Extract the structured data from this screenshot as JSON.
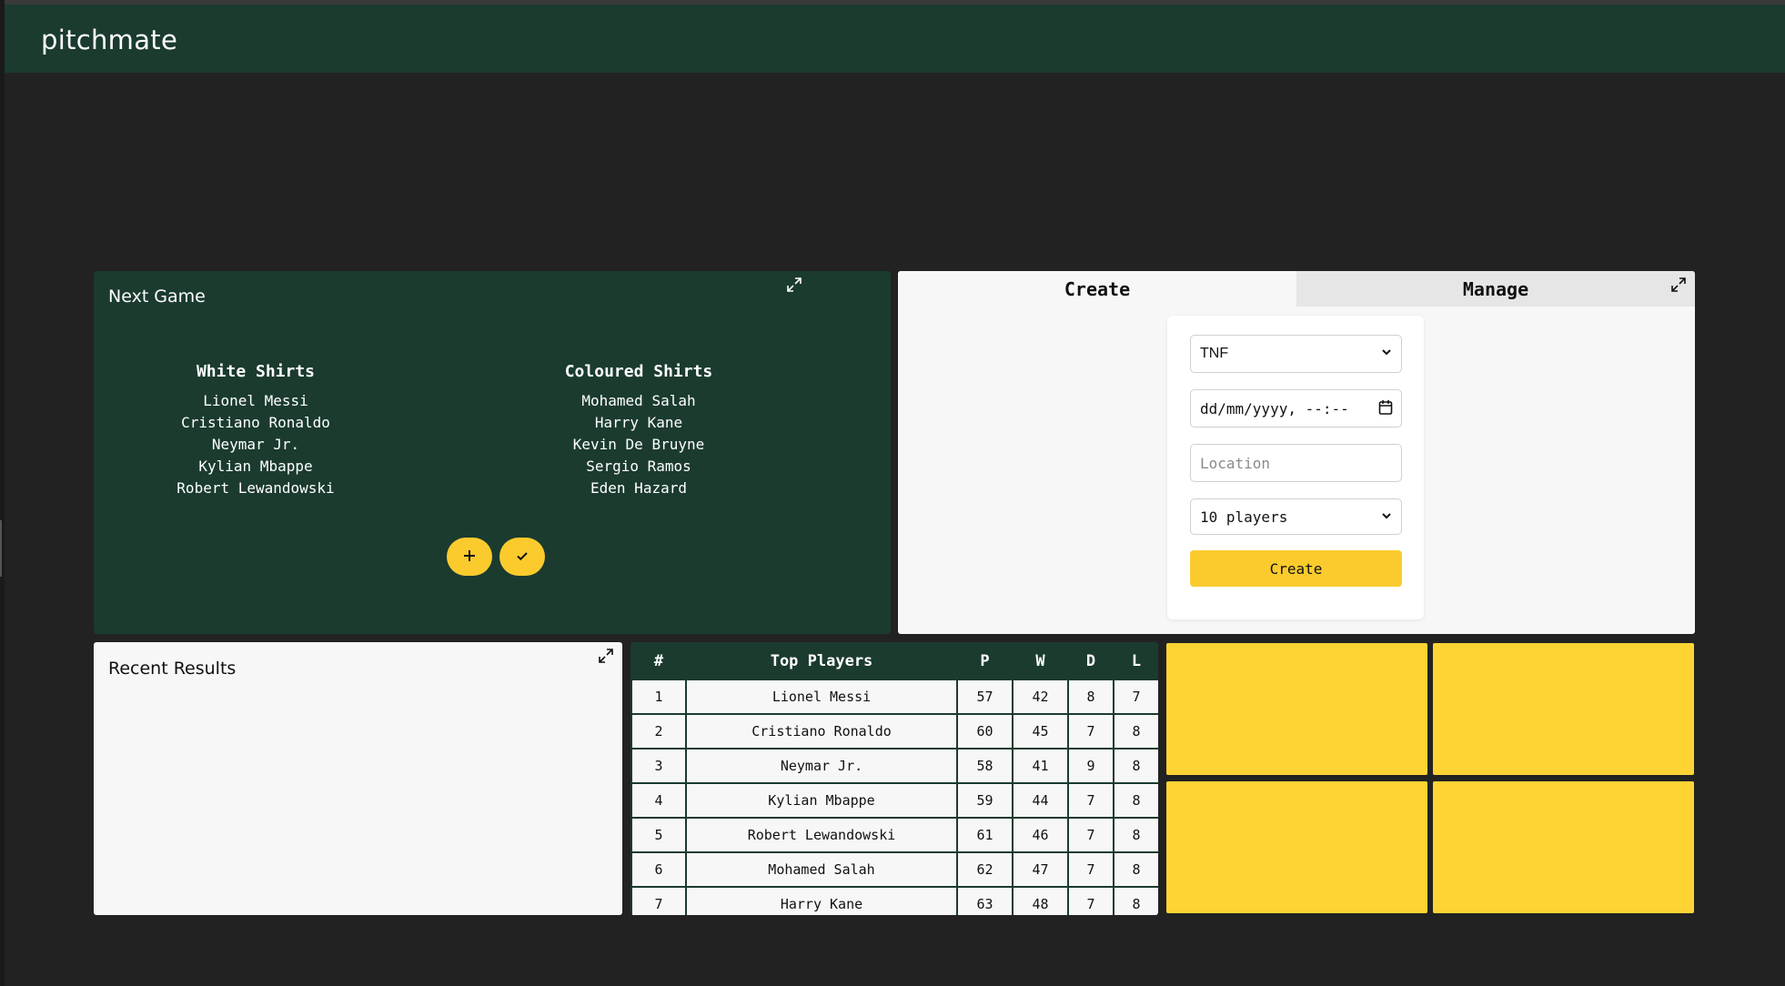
{
  "app": {
    "brand": "pitchmate"
  },
  "next_game": {
    "title": "Next Game",
    "teams": [
      {
        "name": "White Shirts",
        "players": [
          "Lionel Messi",
          "Cristiano Ronaldo",
          "Neymar Jr.",
          "Kylian Mbappe",
          "Robert Lewandowski"
        ]
      },
      {
        "name": "Coloured Shirts",
        "players": [
          "Mohamed Salah",
          "Harry Kane",
          "Kevin De Bruyne",
          "Sergio Ramos",
          "Eden Hazard"
        ]
      }
    ],
    "actions": {
      "add_icon": "plus-icon",
      "confirm_icon": "check-icon",
      "expand_icon": "expand-icon"
    }
  },
  "create_panel": {
    "tabs": [
      "Create",
      "Manage"
    ],
    "active_tab": "Create",
    "game_type_value": "TNF",
    "datetime_placeholder": "dd/mm/yyyy, --:--",
    "location_placeholder": "Location",
    "players_value": "10 players",
    "create_label": "Create"
  },
  "recent_results": {
    "title": "Recent Results"
  },
  "top_players": {
    "headers": [
      "#",
      "Top Players",
      "P",
      "W",
      "D",
      "L"
    ],
    "rows": [
      [
        "1",
        "Lionel Messi",
        "57",
        "42",
        "8",
        "7"
      ],
      [
        "2",
        "Cristiano Ronaldo",
        "60",
        "45",
        "7",
        "8"
      ],
      [
        "3",
        "Neymar Jr.",
        "58",
        "41",
        "9",
        "8"
      ],
      [
        "4",
        "Kylian Mbappe",
        "59",
        "44",
        "7",
        "8"
      ],
      [
        "5",
        "Robert Lewandowski",
        "61",
        "46",
        "7",
        "8"
      ],
      [
        "6",
        "Mohamed Salah",
        "62",
        "47",
        "7",
        "8"
      ],
      [
        "7",
        "Harry Kane",
        "63",
        "48",
        "7",
        "8"
      ]
    ]
  },
  "colors": {
    "background": "#222222",
    "header": "#1b3b2f",
    "card_dark": "#1b3b2f",
    "card_light": "#f7f7f7",
    "accent": "#fbcb2e",
    "tile": "#fed435"
  }
}
